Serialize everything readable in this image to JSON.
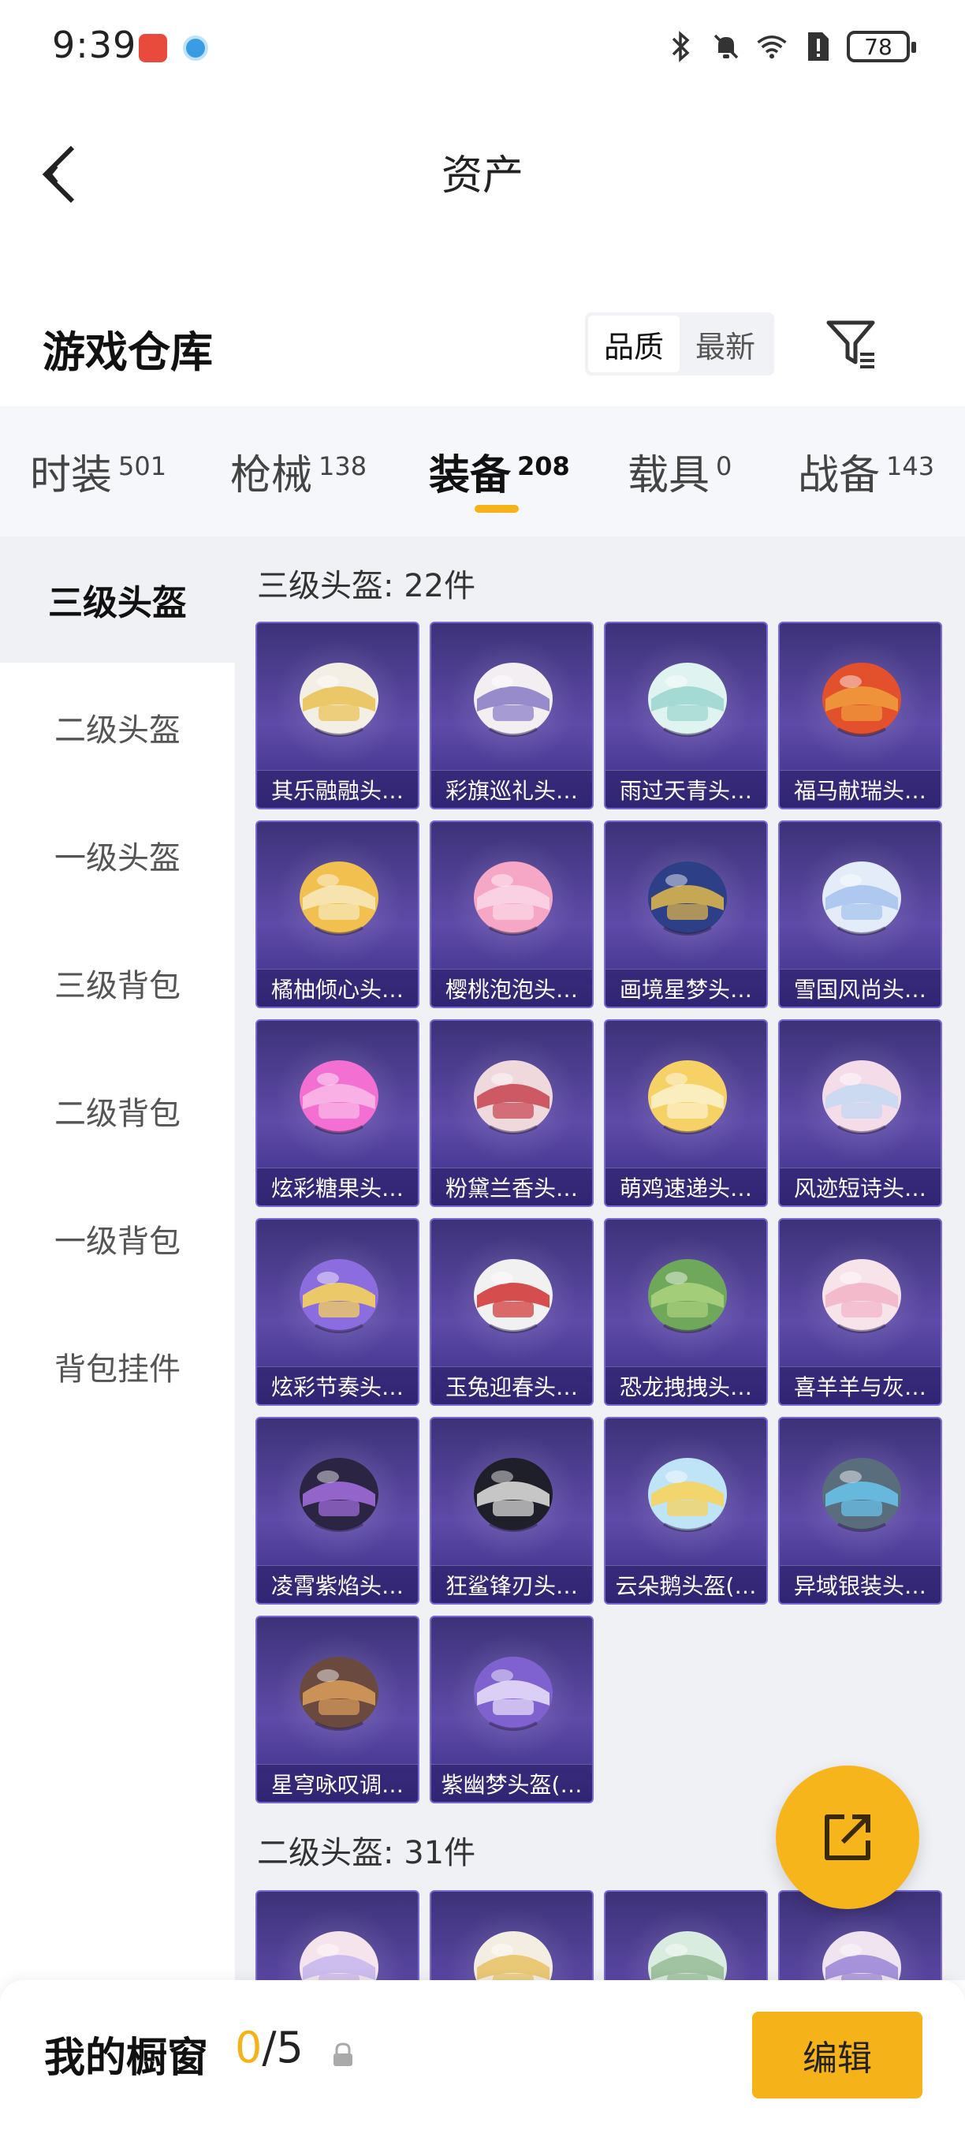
{
  "status_bar": {
    "time": "9:39",
    "battery": "78"
  },
  "header": {
    "title": "资产"
  },
  "warehouse": {
    "title": "游戏仓库",
    "sort_options": [
      "品质",
      "最新"
    ],
    "active_sort": "品质"
  },
  "categories": [
    {
      "label": "时装",
      "count": "501"
    },
    {
      "label": "枪械",
      "count": "138"
    },
    {
      "label": "装备",
      "count": "208"
    },
    {
      "label": "载具",
      "count": "0"
    },
    {
      "label": "战备",
      "count": "143"
    }
  ],
  "side_nav": [
    "三级头盔",
    "二级头盔",
    "一级头盔",
    "三级背包",
    "二级背包",
    "一级背包",
    "背包挂件"
  ],
  "section1": {
    "title": "三级头盔: 22件",
    "items": [
      "其乐融融头…",
      "彩旗巡礼头…",
      "雨过天青头…",
      "福马献瑞头…",
      "橘柚倾心头…",
      "樱桃泡泡头…",
      "画境星梦头…",
      "雪国风尚头…",
      "炫彩糖果头…",
      "粉黛兰香头…",
      "萌鸡速递头…",
      "风迹短诗头…",
      "炫彩节奏头…",
      "玉兔迎春头…",
      "恐龙拽拽头…",
      "喜羊羊与灰…",
      "凌霄紫焰头…",
      "狂鲨锋刃头…",
      "云朵鹅头盔(…",
      "异域银装头…",
      "星穹咏叹调…",
      "紫幽梦头盔(…"
    ]
  },
  "section2": {
    "title": "二级头盔: 31件"
  },
  "bottom": {
    "showcase_label": "我的橱窗",
    "showcase_current": "0",
    "showcase_total": "/5",
    "edit_label": "编辑"
  },
  "colors": {
    "accent": "#f6b219",
    "card_bg": "#4a3c95"
  },
  "icons": {
    "back": "chevron-left-icon",
    "filter": "filter-icon",
    "share": "share-external-icon",
    "lock": "lock-icon"
  }
}
